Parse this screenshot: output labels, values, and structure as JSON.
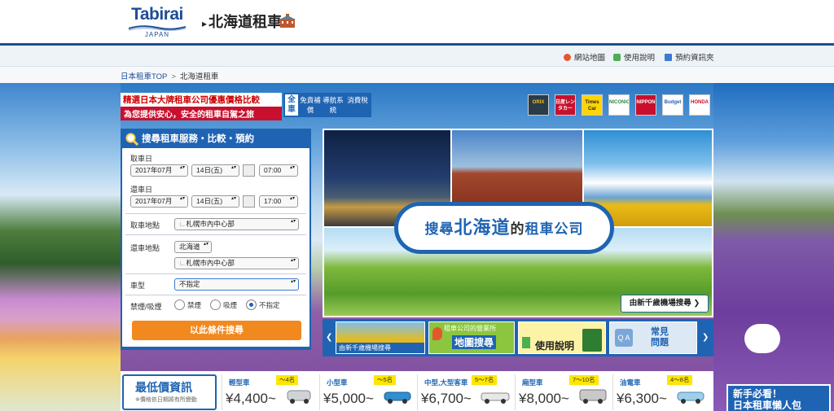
{
  "header": {
    "logo_text": "Tabirai",
    "logo_sub": "JAPAN",
    "site_title": "北海道租車",
    "building_icon": "building-icon"
  },
  "toolbar": {
    "items": [
      {
        "label": "網站地圖",
        "icon": "map-pin-icon",
        "color": "#e4572e"
      },
      {
        "label": "使用說明",
        "icon": "beginner-mark-icon",
        "color": "#4caf50"
      },
      {
        "label": "預約資訊夾",
        "icon": "folder-icon",
        "color": "#3b7bd1"
      }
    ]
  },
  "breadcrumb": {
    "home": "日本租車TOP",
    "separator": ">",
    "current": "北海道租車"
  },
  "promo": {
    "line1": "精選日本大牌租車公司優惠價格比較",
    "line2": "為您提供安心，安全的租車自駕之旅"
  },
  "features": {
    "all": "全車",
    "items": [
      "免責補償",
      "導航系統",
      "消費稅"
    ]
  },
  "brands": [
    "ORIX",
    "日産レンタカー",
    "Times Car",
    "NICONICO",
    "NIPPON",
    "Budget",
    "HONDA"
  ],
  "search": {
    "title": "搜尋租車服務・比較・預約",
    "pickup_label": "取車日",
    "pickup_month": "2017年07月",
    "pickup_day": "14日(五)",
    "pickup_time": "07:00",
    "return_label": "還車日",
    "return_month": "2017年07月",
    "return_day": "14日(五)",
    "return_time": "17:00",
    "pickup_place_label": "取車地點",
    "pickup_place": "札幌市內中心部",
    "return_place_label": "還車地點",
    "return_region": "北海道",
    "return_place": "札幌市內中心部",
    "car_type_label": "車型",
    "car_type": "不指定",
    "smoking_label": "禁煙/吸煙",
    "smoking_options": [
      "禁煙",
      "吸煙",
      "不指定"
    ],
    "smoking_selected": "不指定",
    "submit": "以此條件搜尋"
  },
  "hero": {
    "bubble_pre": "搜尋",
    "bubble_big": "北海道",
    "bubble_mid": "的",
    "bubble_post": "租車公司",
    "airport_button": "由新千歲機場搜尋"
  },
  "thumbs": [
    {
      "caption": "由新千歲機場搜尋"
    },
    {
      "top": "租車公司的營業所",
      "main": "地圖搜尋"
    },
    {
      "main": "使用說明"
    },
    {
      "main": "常見問題"
    }
  ],
  "lowest_price": {
    "title": "最低價資訊",
    "note": "※價格依日期將有所變動",
    "cars": [
      {
        "type": "輕型車",
        "seats": "～4名",
        "price": "¥4,400~",
        "color": "#cfd3d8"
      },
      {
        "type": "小型車",
        "seats": "～5名",
        "price": "¥5,000~",
        "color": "#2f8fd0"
      },
      {
        "type": "中型,大型客車",
        "seats": "5～7名",
        "price": "¥6,700~",
        "color": "#e8e8e8"
      },
      {
        "type": "廂型車",
        "seats": "7～10名",
        "price": "¥8,000~",
        "color": "#c9c9c9"
      },
      {
        "type": "油電車",
        "seats": "4～8名",
        "price": "¥6,300~",
        "color": "#9fcfea"
      }
    ]
  },
  "side_promo": {
    "line1": "新手必看！",
    "line2": "日本租車懶人包"
  }
}
